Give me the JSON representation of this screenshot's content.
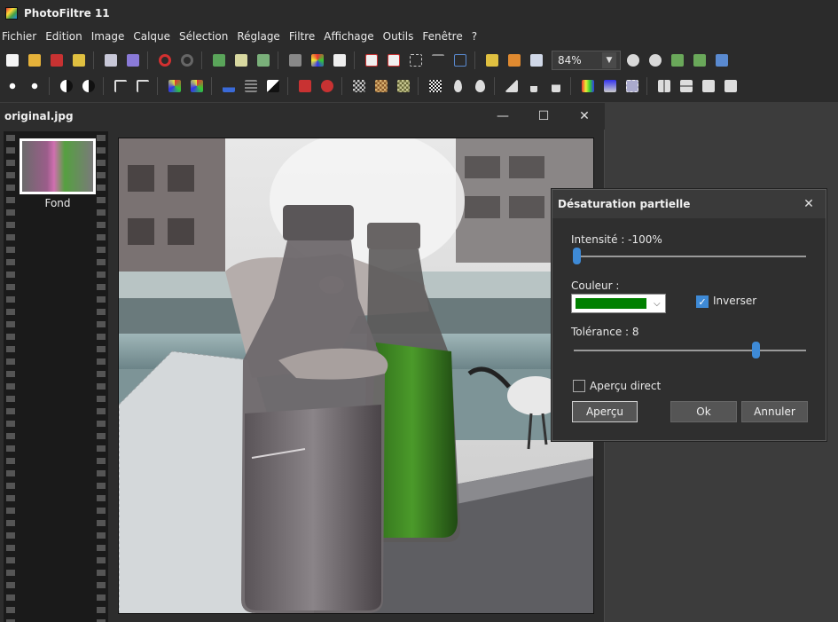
{
  "app": {
    "title": "PhotoFiltre 11"
  },
  "menu": [
    "Fichier",
    "Edition",
    "Image",
    "Calque",
    "Sélection",
    "Réglage",
    "Filtre",
    "Affichage",
    "Outils",
    "Fenêtre",
    "?"
  ],
  "toolbar": {
    "zoom_value": "84%"
  },
  "document": {
    "title": "original.jpg",
    "layer_name": "Fond"
  },
  "dialog": {
    "title": "Désaturation partielle",
    "intensity_label": "Intensité : -100%",
    "intensity_value": -100,
    "color_label": "Couleur :",
    "color_value": "#008000",
    "invert_label": "Inverser",
    "invert_checked": true,
    "tolerance_label": "Tolérance : 8",
    "tolerance_value": 8,
    "live_preview_label": "Aperçu direct",
    "live_preview_checked": false,
    "preview_button": "Aperçu",
    "ok_button": "Ok",
    "cancel_button": "Annuler"
  },
  "colors": {
    "accent": "#3e8ad6",
    "background": "#2b2b2b",
    "dialog": "#2f2f2f"
  }
}
